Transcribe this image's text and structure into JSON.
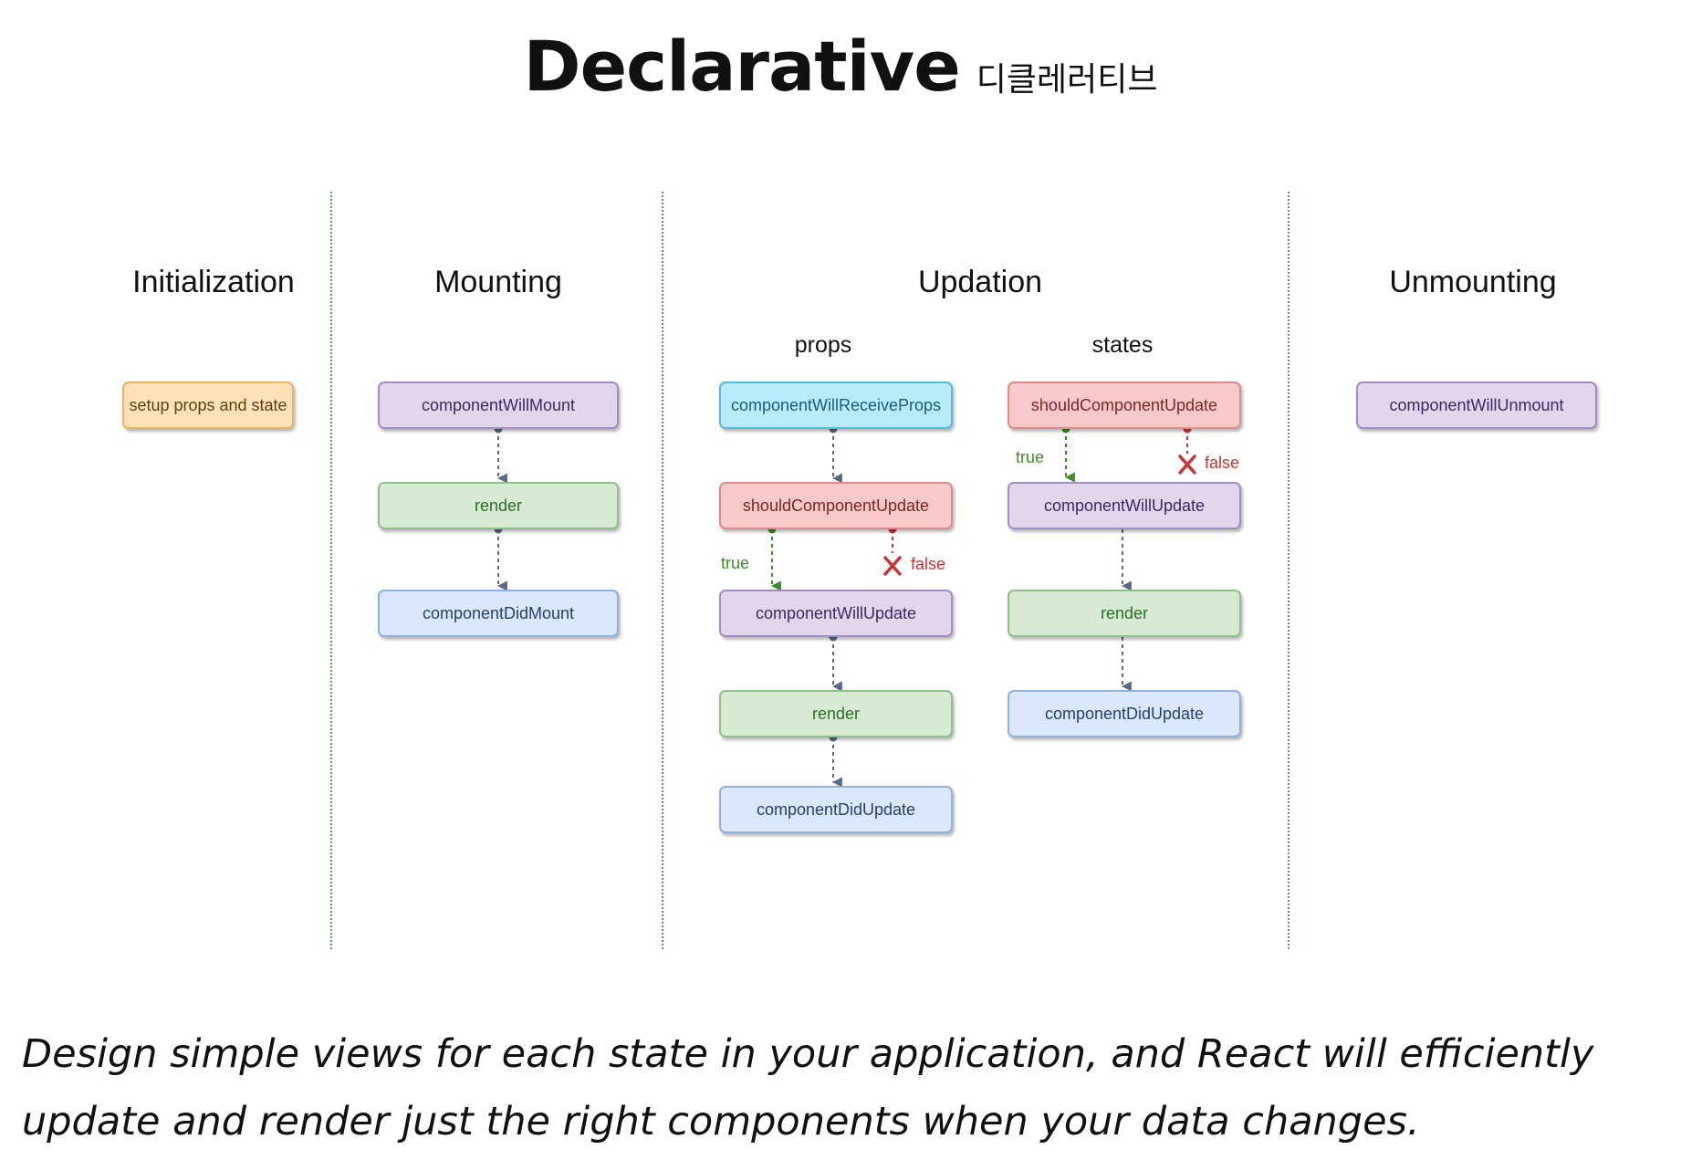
{
  "title": {
    "main": "Declarative",
    "sub": "디클레러티브"
  },
  "phases": {
    "initialization": "Initialization",
    "mounting": "Mounting",
    "updation": "Updation",
    "unmounting": "Unmounting"
  },
  "subheads": {
    "props": "props",
    "states": "states"
  },
  "boxes": {
    "init_setup": "setup props and state",
    "mount_will": "componentWillMount",
    "mount_render": "render",
    "mount_did": "componentDidMount",
    "props_receive": "componentWillReceiveProps",
    "props_should": "shouldComponentUpdate",
    "props_will": "componentWillUpdate",
    "props_render": "render",
    "props_did": "componentDidUpdate",
    "states_should": "shouldComponentUpdate",
    "states_will": "componentWillUpdate",
    "states_render": "render",
    "states_did": "componentDidUpdate",
    "unmount_will": "componentWillUnmount"
  },
  "labels": {
    "props_true": "true",
    "props_false": "false",
    "states_true": "true",
    "states_false": "false"
  },
  "colors": {
    "purple": "#e2d6ec",
    "green": "#d6ebd2",
    "blue": "#dbe8fb",
    "cyan": "#b8ecfb",
    "red": "#f7c9c9",
    "orange": "#fde2b8",
    "true_label": "#3d8c2a",
    "false_label": "#cc3333"
  },
  "caption": {
    "line1": "Design simple views for each state in your application, and React will efficiently",
    "line2": "update and render just the right components when your data changes."
  }
}
